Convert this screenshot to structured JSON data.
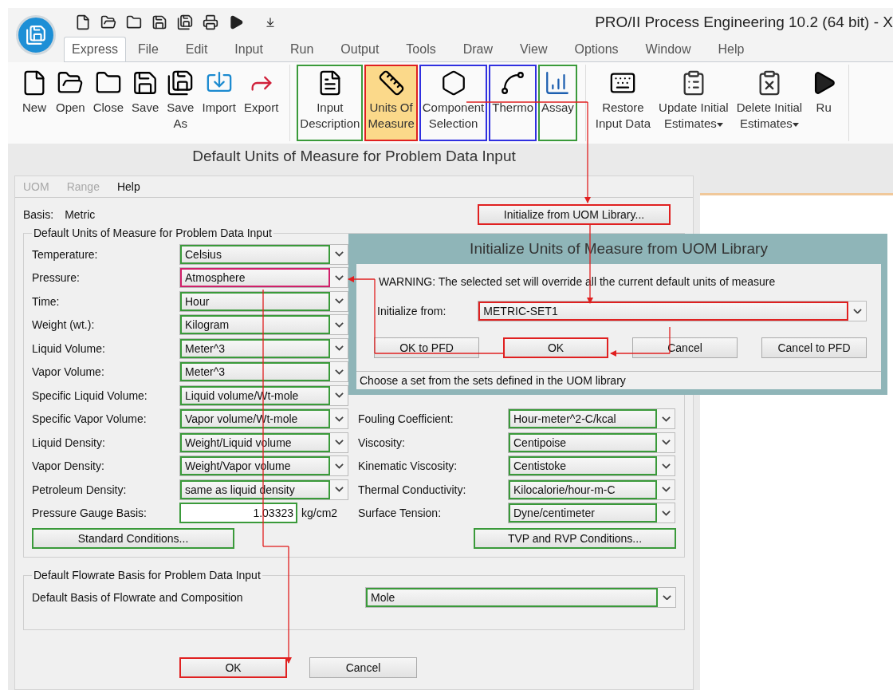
{
  "app": {
    "title": "PRO/II Process Engineering 10.2 (64 bit) - X"
  },
  "tabs": [
    {
      "label": "Express",
      "selected": true
    },
    {
      "label": "File",
      "selected": false
    },
    {
      "label": "Edit",
      "selected": false
    },
    {
      "label": "Input",
      "selected": false
    },
    {
      "label": "Run",
      "selected": false
    },
    {
      "label": "Output",
      "selected": false
    },
    {
      "label": "Tools",
      "selected": false
    },
    {
      "label": "Draw",
      "selected": false
    },
    {
      "label": "View",
      "selected": false
    },
    {
      "label": "Options",
      "selected": false
    },
    {
      "label": "Window",
      "selected": false
    },
    {
      "label": "Help",
      "selected": false
    }
  ],
  "ribbon": {
    "groups": [
      {
        "items": [
          {
            "kind": "new",
            "lines": [
              "New"
            ],
            "menu": false,
            "selected": false
          },
          {
            "kind": "open",
            "lines": [
              "Open"
            ],
            "menu": false,
            "selected": false
          },
          {
            "kind": "close",
            "lines": [
              "Close"
            ],
            "menu": false,
            "selected": false
          },
          {
            "kind": "save",
            "lines": [
              "Save"
            ],
            "menu": false,
            "selected": false
          },
          {
            "kind": "saveas",
            "lines": [
              "Save",
              "As"
            ],
            "menu": false,
            "selected": false
          },
          {
            "kind": "import",
            "lines": [
              "Import"
            ],
            "menu": false,
            "selected": false
          },
          {
            "kind": "export",
            "lines": [
              "Export"
            ],
            "menu": false,
            "selected": false
          }
        ]
      },
      {
        "items": [
          {
            "kind": "description",
            "lines": [
              "Input",
              "Description"
            ],
            "menu": false,
            "selected": false,
            "color": "#3a9a3a"
          },
          {
            "kind": "units",
            "lines": [
              "Units Of",
              "Measure"
            ],
            "menu": false,
            "selected": true,
            "color": "#e02020"
          },
          {
            "kind": "component",
            "lines": [
              "Component",
              "Selection"
            ],
            "menu": false,
            "selected": false,
            "color": "#3030e0"
          },
          {
            "kind": "thermo",
            "lines": [
              "Thermo"
            ],
            "menu": false,
            "selected": false,
            "color": "#3030e0"
          },
          {
            "kind": "assay",
            "lines": [
              "Assay"
            ],
            "menu": false,
            "selected": false,
            "color": "#3a9a3a"
          }
        ]
      },
      {
        "items": [
          {
            "kind": "restore",
            "lines": [
              "Restore",
              "Input Data"
            ],
            "menu": false,
            "selected": false
          },
          {
            "kind": "update",
            "lines": [
              "Update Initial",
              "Estimates"
            ],
            "menu": true,
            "selected": false
          },
          {
            "kind": "delete",
            "lines": [
              "Delete Initial",
              "Estimates"
            ],
            "menu": true,
            "selected": false
          },
          {
            "kind": "run",
            "lines": [
              "Ru"
            ],
            "menu": false,
            "selected": false
          }
        ]
      }
    ]
  },
  "dialog": {
    "title": "Default Units of Measure for Problem Data Input",
    "menu": [
      {
        "label": "UOM",
        "disabled": true
      },
      {
        "label": "Range",
        "disabled": true
      },
      {
        "label": "Help",
        "disabled": false
      }
    ],
    "basis_label": "Basis:",
    "basis_value": "Metric",
    "init_button": {
      "label": "Initialize from UOM Library...",
      "color": "#e02020"
    },
    "group_title": "Default Units of Measure for Problem Data Input",
    "left_rows": [
      {
        "label": "Temperature:",
        "value": "Celsius",
        "color": "#3a9a3a"
      },
      {
        "label": "Pressure:",
        "value": "Atmosphere",
        "color": "#d0206a"
      },
      {
        "label": "Time:",
        "value": "Hour",
        "color": "#3a9a3a"
      },
      {
        "label": "Weight (wt.):",
        "value": "Kilogram",
        "color": "#3a9a3a"
      },
      {
        "label": "Liquid Volume:",
        "value": "Meter^3",
        "color": "#3a9a3a"
      },
      {
        "label": "Vapor Volume:",
        "value": "Meter^3",
        "color": "#3a9a3a"
      },
      {
        "label": "Specific Liquid Volume:",
        "value": "Liquid volume/Wt-mole",
        "color": "#3a9a3a"
      },
      {
        "label": "Specific Vapor Volume:",
        "value": "Vapor volume/Wt-mole",
        "color": "#3a9a3a"
      },
      {
        "label": "Liquid Density:",
        "value": "Weight/Liquid volume",
        "color": "#3a9a3a"
      },
      {
        "label": "Vapor Density:",
        "value": "Weight/Vapor volume",
        "color": "#3a9a3a"
      },
      {
        "label": "Petroleum Density:",
        "value": "same as liquid density",
        "color": "#3a9a3a"
      }
    ],
    "gauge": {
      "label": "Pressure Gauge Basis:",
      "value": "1.03323",
      "unit": "kg/cm2",
      "color": "#3a9a3a"
    },
    "right_rows": [
      {
        "label": "Fouling Coefficient:",
        "value": "Hour-meter^2-C/kcal",
        "color": "#3a9a3a"
      },
      {
        "label": "Viscosity:",
        "value": "Centipoise",
        "color": "#3a9a3a"
      },
      {
        "label": "Kinematic Viscosity:",
        "value": "Centistoke",
        "color": "#3a9a3a"
      },
      {
        "label": "Thermal Conductivity:",
        "value": "Kilocalorie/hour-m-C",
        "color": "#3a9a3a"
      },
      {
        "label": "Surface Tension:",
        "value": "Dyne/centimeter",
        "color": "#3a9a3a"
      }
    ],
    "buttons": [
      {
        "label": "Standard Conditions...",
        "color": "#3a9a3a"
      },
      {
        "label": "TVP and RVP Conditions...",
        "color": "#3a9a3a"
      }
    ],
    "flow_group": {
      "title": "Default Flowrate Basis for Problem Data Input",
      "label": "Default Basis of Flowrate and Composition",
      "value": "Mole",
      "color": "#3a9a3a"
    },
    "footer_buttons": [
      {
        "label": "OK",
        "color": "#e02020"
      },
      {
        "label": "Cancel"
      }
    ]
  },
  "overlay": {
    "title": "Initialize Units of Measure from UOM Library",
    "warning": "WARNING: The selected set will override all the current default units of measure",
    "from": {
      "label": "Initialize from:",
      "value": "METRIC-SET1",
      "color": "#e02020"
    },
    "buttons": [
      {
        "label": "OK to PFD"
      },
      {
        "label": "OK",
        "color": "#e02020"
      },
      {
        "label": "Cancel"
      },
      {
        "label": "Cancel to PFD"
      }
    ],
    "status": "Choose a set from the sets defined in the UOM library"
  }
}
